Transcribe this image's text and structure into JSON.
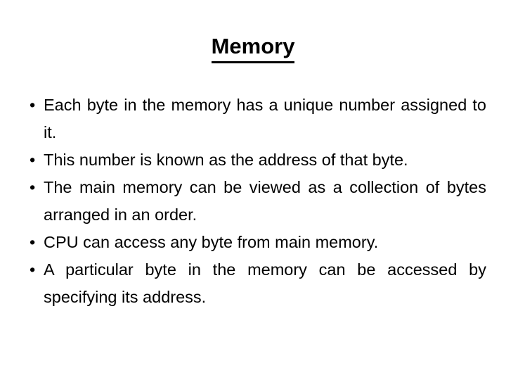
{
  "slide": {
    "title": "Memory",
    "title_underlined": true,
    "background_color": "#ffffff",
    "text_color": "#000000",
    "bullet_marker": "•",
    "bullets": [
      {
        "text": "Each byte in the memory has a unique number assigned to it.",
        "lines": 2
      },
      {
        "text": "This number is known as the address of that byte.",
        "lines": 2
      },
      {
        "text": "The main memory can be viewed as a collection of bytes arranged in an order.",
        "lines": 2
      },
      {
        "text": "CPU can access any byte from main memory.",
        "lines": 1
      },
      {
        "text": "A particular byte in the memory can be accessed by specifying its address.",
        "lines": 2
      }
    ]
  }
}
